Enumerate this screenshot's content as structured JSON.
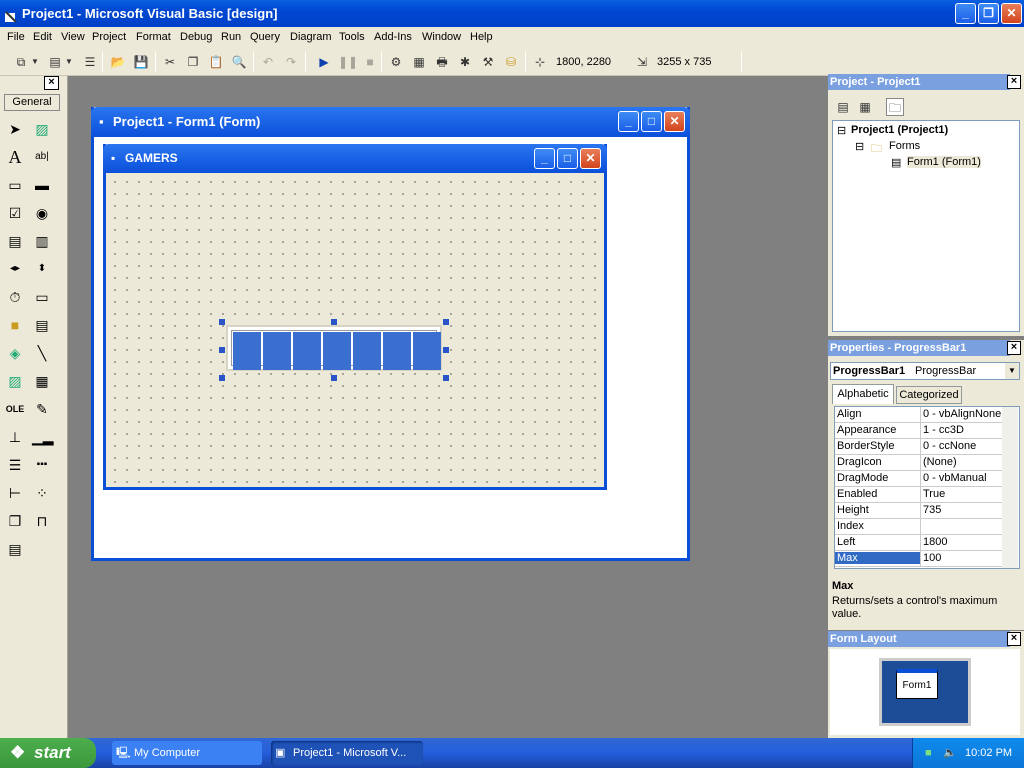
{
  "app": {
    "title": "Project1 - Microsoft Visual Basic [design]",
    "menu": [
      "File",
      "Edit",
      "View",
      "Project",
      "Format",
      "Debug",
      "Run",
      "Query",
      "Diagram",
      "Tools",
      "Add-Ins",
      "Window",
      "Help"
    ]
  },
  "toolbar": {
    "position": "1800, 2280",
    "size": "3255 x 735"
  },
  "toolbox": {
    "tab_label": "General",
    "close": "×"
  },
  "designer": {
    "window_title": "Project1 - Form1 (Form)",
    "form_caption": "GAMERS",
    "progress_segments": 7
  },
  "project_explorer": {
    "title": "Project - Project1",
    "root": "Project1 (Project1)",
    "folder": "Forms",
    "item": "Form1 (Form1)"
  },
  "properties": {
    "title": "Properties - ProgressBar1",
    "object_name": "ProgressBar1",
    "object_type": "ProgressBar",
    "tabs": [
      "Alphabetic",
      "Categorized"
    ],
    "rows": [
      {
        "name": "Align",
        "value": "0 - vbAlignNone"
      },
      {
        "name": "Appearance",
        "value": "1 - cc3D"
      },
      {
        "name": "BorderStyle",
        "value": "0 - ccNone"
      },
      {
        "name": "DragIcon",
        "value": "(None)"
      },
      {
        "name": "DragMode",
        "value": "0 - vbManual"
      },
      {
        "name": "Enabled",
        "value": "True"
      },
      {
        "name": "Height",
        "value": "735"
      },
      {
        "name": "Index",
        "value": ""
      },
      {
        "name": "Left",
        "value": "1800"
      },
      {
        "name": "Max",
        "value": "100"
      }
    ],
    "desc_title": "Max",
    "desc_text": "Returns/sets a control's maximum value."
  },
  "form_layout": {
    "title": "Form Layout",
    "form_label": "Form1"
  },
  "taskbar": {
    "start": "start",
    "tasks": [
      "My Computer",
      "Project1 - Microsoft V..."
    ],
    "clock": "10:02 PM"
  }
}
